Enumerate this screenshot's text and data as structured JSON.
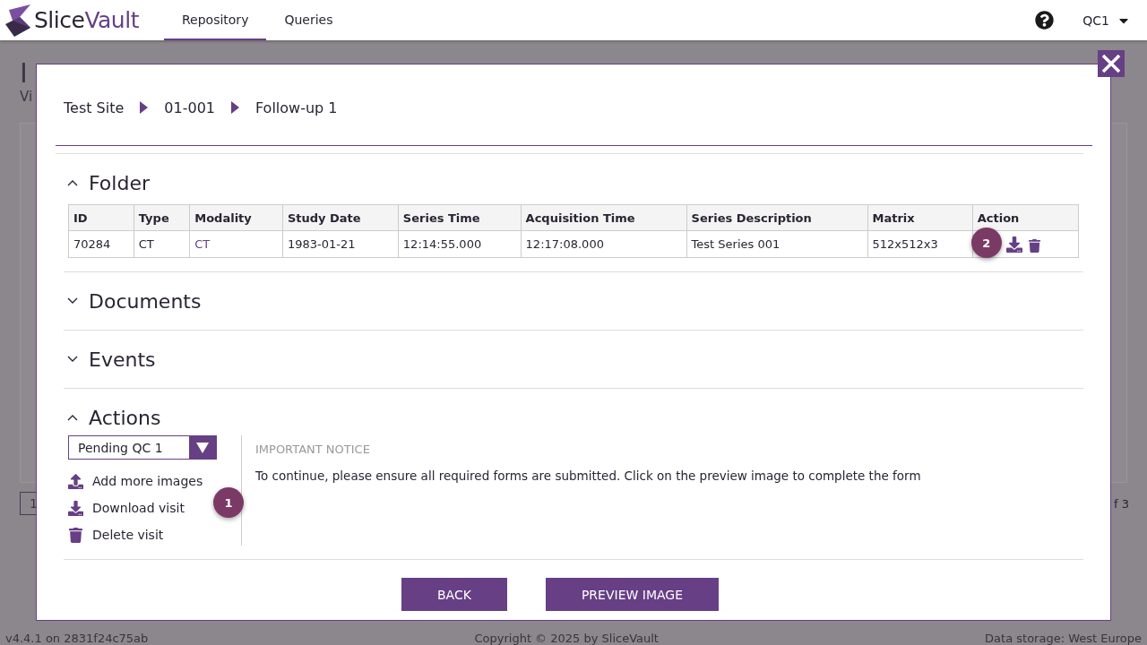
{
  "header": {
    "brand": [
      "Slice",
      "Vault"
    ],
    "tabs": [
      {
        "label": "Repository",
        "selected": true
      },
      {
        "label": "Queries",
        "selected": false
      }
    ],
    "user": "QC1"
  },
  "background": {
    "title": "I",
    "subtitle": "Vi",
    "pager_page": "1",
    "pager_total": "f 3"
  },
  "modal": {
    "breadcrumb": [
      "Test Site",
      "01-001",
      "Follow-up 1"
    ],
    "sections": [
      {
        "title": "Folder",
        "expanded": true,
        "kind": "table"
      },
      {
        "title": "Documents",
        "expanded": false
      },
      {
        "title": "Events",
        "expanded": false
      },
      {
        "title": "Actions",
        "expanded": true,
        "kind": "actions"
      }
    ],
    "table": {
      "columns": [
        "ID",
        "Type",
        "Modality",
        "Study Date",
        "Series Time",
        "Acquisition Time",
        "Series Description",
        "Matrix",
        "Action"
      ],
      "rows": [
        {
          "cells": [
            "70284",
            "CT",
            "CT",
            "1983-01-21",
            "12:14:55.000",
            "12:17:08.000",
            "Test Series 001",
            "512x512x3"
          ],
          "marker": "2"
        }
      ]
    },
    "status_select": "Pending QC 1",
    "actions": [
      {
        "label": "Add more images",
        "kind": "upload"
      },
      {
        "label": "Download visit",
        "kind": "download"
      },
      {
        "label": "Delete visit",
        "kind": "delete"
      }
    ],
    "actions_marker": "1",
    "notice": {
      "title": "IMPORTANT NOTICE",
      "text": "To continue, please ensure all required forms are submitted. Click on the preview image to complete the form"
    },
    "buttons": [
      "BACK",
      "PREVIEW IMAGE"
    ]
  },
  "footer": {
    "version": "v4.4.1 on 2831f24c75ab",
    "copyright": "Copyright © 2025 by SliceVault",
    "storage": "Data storage: West Europe"
  }
}
